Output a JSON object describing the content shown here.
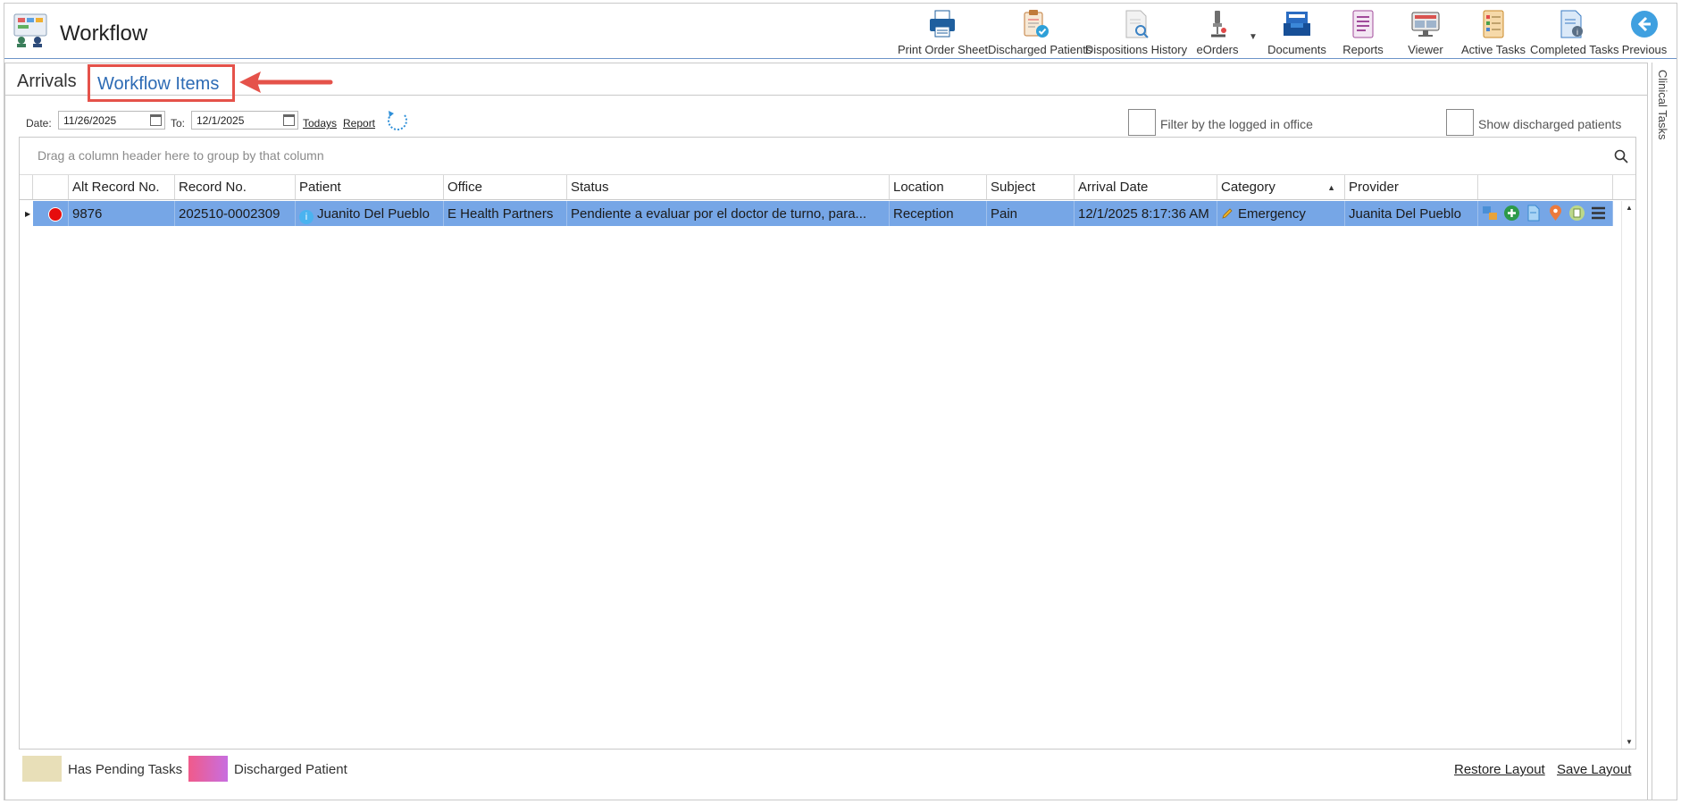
{
  "app": {
    "title": "Workflow",
    "icon": "workflow-board-icon"
  },
  "toolbar": {
    "items": [
      {
        "label": "Print Order Sheet",
        "icon": "printer-icon"
      },
      {
        "label": "Discharged Patients",
        "icon": "discharged-clipboard-icon"
      },
      {
        "label": "Dispositions History",
        "icon": "document-search-icon"
      },
      {
        "label": "eOrders",
        "icon": "microscope-icon"
      },
      {
        "label": "Documents",
        "icon": "inbox-tray-icon"
      },
      {
        "label": "Reports",
        "icon": "report-sheet-icon"
      },
      {
        "label": "Viewer",
        "icon": "monitor-icon"
      },
      {
        "label": "Active Tasks",
        "icon": "task-list-icon"
      },
      {
        "label": "Completed Tasks",
        "icon": "completed-document-icon"
      },
      {
        "label": "Previous",
        "icon": "back-arrow-icon"
      }
    ]
  },
  "tabs": {
    "arrivals": "Arrivals",
    "workflow_items": "Workflow Items"
  },
  "side_panel": {
    "label": "Clinical Tasks"
  },
  "filters": {
    "date_label": "Date:",
    "date_from": "11/26/2025",
    "to_label": "To:",
    "date_to": "12/1/2025",
    "todays_link": "Todays",
    "report_link": "Report",
    "filter_office_label": "Filter by the logged in office",
    "show_discharged_label": "Show discharged patients"
  },
  "grid": {
    "group_panel_text": "Drag a column header here to group by that column",
    "columns": [
      "Alt Record No.",
      "Record No.",
      "Patient",
      "Office",
      "Status",
      "Location",
      "Subject",
      "Arrival Date",
      "Category",
      "Provider"
    ],
    "sort_column": "Category",
    "rows": [
      {
        "status_color": "#e60d0d",
        "alt_record_no": "9876",
        "record_no": "202510-0002309",
        "patient": "Juanito Del Pueblo",
        "office": "E Health Partners",
        "status": "Pendiente a evaluar por el doctor de turno, para...",
        "location": "Reception",
        "subject": "Pain",
        "arrival_date": "12/1/2025 8:17:36 AM",
        "category": "Emergency",
        "provider": "Juanita Del Pueblo",
        "action_icons": [
          "transfer-icon",
          "add-circle-icon",
          "document-icon",
          "location-pin-icon",
          "clipboard-icon",
          "menu-icon"
        ]
      }
    ]
  },
  "footer": {
    "legend": [
      {
        "label": "Has Pending Tasks",
        "color": "#e8dfb8"
      },
      {
        "label": "Discharged Patient",
        "color": "#e066c0"
      }
    ],
    "restore_layout": "Restore Layout",
    "save_layout": "Save Layout"
  },
  "colors": {
    "selected_row": "#76a6e6",
    "accent_link": "#2d6bb5",
    "highlight": "#e5524a"
  }
}
